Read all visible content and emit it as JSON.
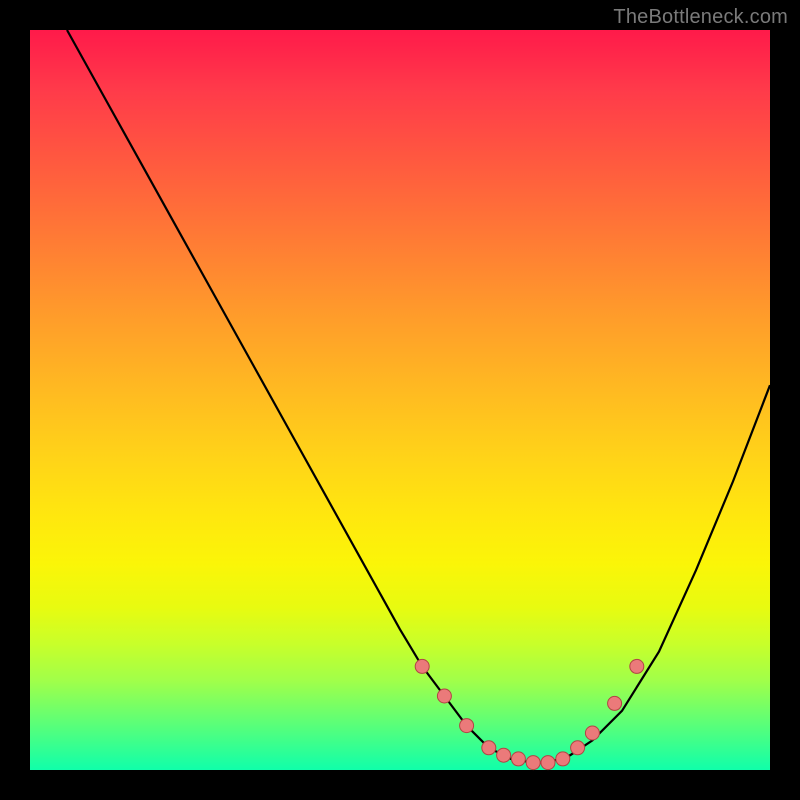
{
  "watermark": "TheBottleneck.com",
  "colors": {
    "background": "#000000",
    "gradient_top": "#ff1a4a",
    "gradient_bottom": "#10ffaa",
    "curve": "#000000",
    "marker_fill": "#eb7a7a",
    "marker_stroke": "#b24444"
  },
  "chart_data": {
    "type": "line",
    "title": "",
    "xlabel": "",
    "ylabel": "",
    "xlim": [
      0,
      100
    ],
    "ylim": [
      0,
      100
    ],
    "note": "Axes have no tick labels; x = horizontal position (0 left → 100 right), y = vertical position (0 bottom → 100 top). Values estimated from pixels.",
    "series": [
      {
        "name": "curve",
        "x": [
          5,
          10,
          15,
          20,
          25,
          30,
          35,
          40,
          45,
          50,
          53,
          56,
          59,
          62,
          65,
          68,
          70,
          73,
          76,
          80,
          85,
          90,
          95,
          100
        ],
        "y": [
          100,
          91,
          82,
          73,
          64,
          55,
          46,
          37,
          28,
          19,
          14,
          10,
          6,
          3,
          1.5,
          1,
          1,
          2,
          4,
          8,
          16,
          27,
          39,
          52
        ]
      }
    ],
    "markers": {
      "name": "highlight-points",
      "x": [
        53,
        56,
        59,
        62,
        64,
        66,
        68,
        70,
        72,
        74,
        76,
        79,
        82
      ],
      "y": [
        14,
        10,
        6,
        3,
        2,
        1.5,
        1,
        1,
        1.5,
        3,
        5,
        9,
        14
      ]
    }
  }
}
